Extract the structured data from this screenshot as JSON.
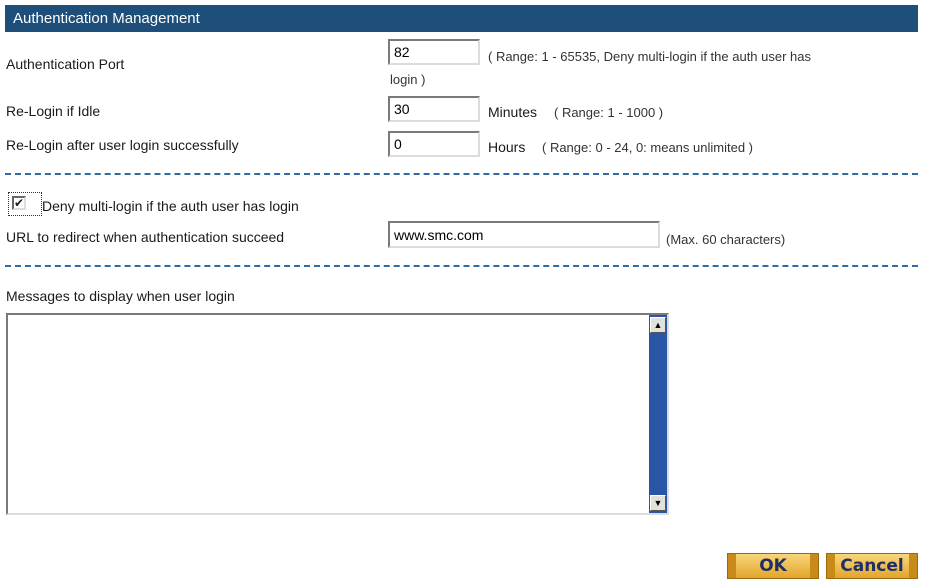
{
  "header": {
    "title": "Authentication Management"
  },
  "auth_port": {
    "label": "Authentication Port",
    "value": "82",
    "hint_line1": "( Range: 1 - 65535, Deny multi-login if the auth user has",
    "hint_line2": "login )"
  },
  "relogin_idle": {
    "label": "Re-Login if Idle",
    "value": "30",
    "unit": "Minutes",
    "hint": "( Range: 1 - 1000 )"
  },
  "relogin_after": {
    "label": "Re-Login after user login successfully",
    "value": "0",
    "unit": "Hours",
    "hint": "( Range: 0 - 24, 0: means unlimited )"
  },
  "deny_multi": {
    "label": "Deny multi-login if the auth user has login",
    "checked": true,
    "check_glyph": "✔"
  },
  "redirect_url": {
    "label": "URL to redirect when authentication succeed",
    "value": "www.smc.com",
    "hint": "(Max. 60 characters)"
  },
  "messages": {
    "label": "Messages to display when user login",
    "value": ""
  },
  "scroll": {
    "up_glyph": "▲",
    "down_glyph": "▼"
  },
  "buttons": {
    "ok": "OK",
    "cancel": "Cancel"
  }
}
